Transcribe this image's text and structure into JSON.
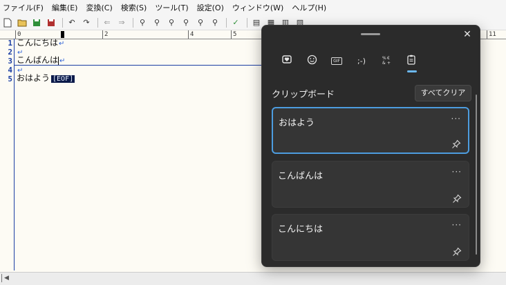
{
  "menu": [
    "ファイル(F)",
    "編集(E)",
    "変換(C)",
    "検索(S)",
    "ツール(T)",
    "設定(O)",
    "ウィンドウ(W)",
    "ヘルプ(H)"
  ],
  "ruler": {
    "marks": [
      "0",
      "2",
      "4",
      "5",
      "11"
    ]
  },
  "editor": {
    "line_numbers": [
      "1",
      "2",
      "3",
      "4",
      "5"
    ],
    "lines": [
      "こんにちは",
      "",
      "こんばんは",
      "",
      "おはよう"
    ],
    "return_mark": "↵",
    "eof_marker": "[EOF]"
  },
  "clipboard": {
    "title": "クリップボード",
    "clear_all_label": "すべてクリア",
    "close_glyph": "✕",
    "more_glyph": "···",
    "tabs": [
      {
        "name": "favorites-tab",
        "glyph": "♥"
      },
      {
        "name": "emoji-tab",
        "glyph": "☺"
      },
      {
        "name": "gif-tab",
        "glyph": "GIF"
      },
      {
        "name": "kaomoji-tab",
        "glyph": ";-)"
      },
      {
        "name": "symbols-tab",
        "glyph": "Ω"
      },
      {
        "name": "clipboard-tab",
        "glyph": "📋"
      }
    ],
    "items": [
      "おはよう",
      "こんばんは",
      "こんにちは"
    ]
  },
  "colors": {
    "panel_bg": "#2b2b2b",
    "accent": "#4d9de0",
    "line_number": "#1a3da3"
  }
}
